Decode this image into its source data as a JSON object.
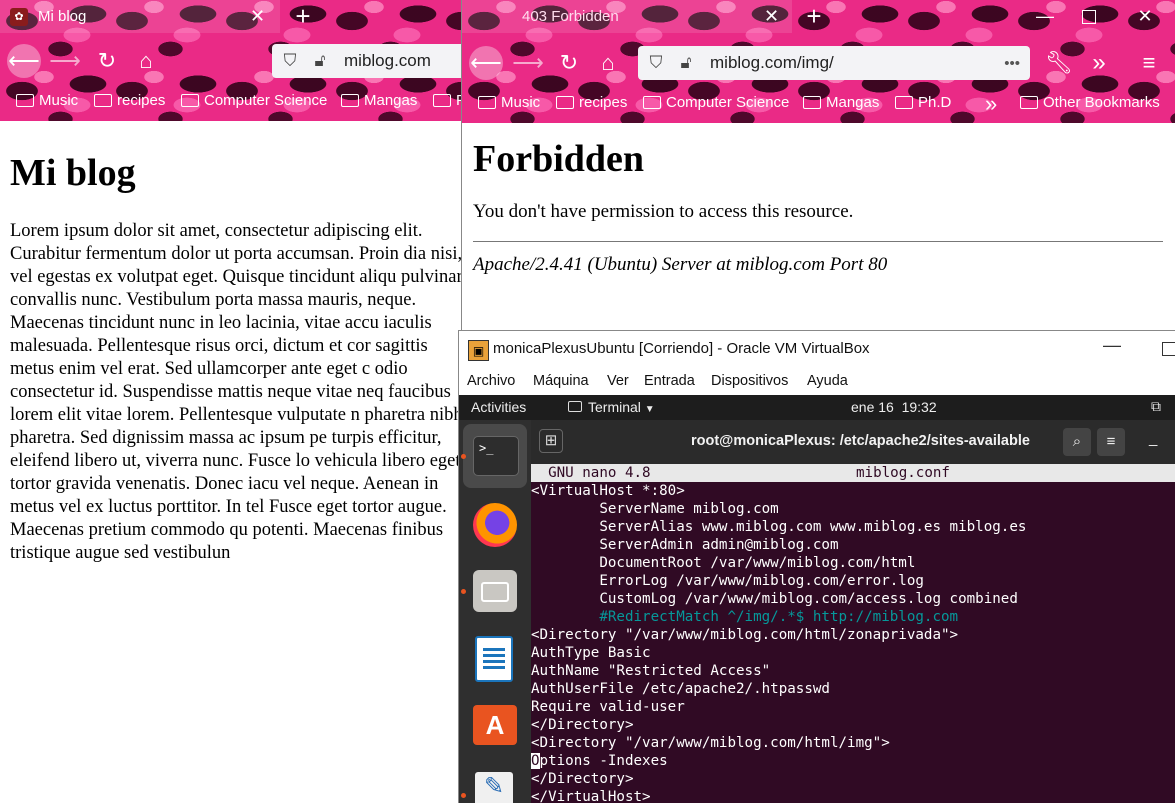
{
  "left_browser": {
    "tab_title": "Mi blog",
    "url": "miblog.com",
    "bookmarks": [
      "Music",
      "recipes",
      "Computer Science",
      "Mangas",
      "P"
    ],
    "page": {
      "heading": "Mi blog",
      "body": "Lorem ipsum dolor sit amet, consectetur adipiscing elit. Curabitur fermentum dolor ut porta accumsan. Proin dia nisi, vel egestas ex volutpat eget. Quisque tincidunt aliqu pulvinar convallis nunc. Vestibulum porta massa mauris, neque. Maecenas tincidunt nunc in leo lacinia, vitae accu iaculis malesuada. Pellentesque risus orci, dictum et cor sagittis metus enim vel erat. Sed ullamcorper ante eget c odio consectetur id. Suspendisse mattis neque vitae neq faucibus lorem elit vitae lorem. Pellentesque vulputate n pharetra nibh pharetra. Sed dignissim massa ac ipsum pe turpis efficitur, eleifend libero ut, viverra nunc. Fusce lo vehicula libero eget tortor gravida venenatis. Donec iacu vel neque. Aenean in metus vel ex luctus porttitor. In tel Fusce eget tortor augue. Maecenas pretium commodo qu potenti. Maecenas finibus tristique augue sed vestibulun"
    }
  },
  "right_browser": {
    "tab_title": "403 Forbidden",
    "url": "miblog.com/img/",
    "url_more": "•••",
    "overflow_label": "»",
    "bookmarks": [
      "Music",
      "recipes",
      "Computer Science",
      "Mangas",
      "Ph.D"
    ],
    "other_bookmarks": "Other Bookmarks",
    "page": {
      "heading": "Forbidden",
      "message": "You don't have permission to access this resource.",
      "server_signature": "Apache/2.4.41 (Ubuntu) Server at miblog.com Port 80"
    }
  },
  "virtualbox": {
    "title": "monicaPlexusUbuntu [Corriendo] - Oracle VM VirtualBox",
    "menu": [
      "Archivo",
      "Máquina",
      "Ver",
      "Entrada",
      "Dispositivos",
      "Ayuda"
    ]
  },
  "ubuntu": {
    "activities": "Activities",
    "app_menu": "Terminal",
    "clock": "ene 16  19:32",
    "terminal_title": "root@monicaPlexus: /etc/apache2/sites-available",
    "nano_version": "  GNU nano 4.8",
    "nano_file": "miblog.conf",
    "lines": [
      {
        "text": "<VirtualHost *:80>",
        "comment": false
      },
      {
        "text": "        ServerName miblog.com",
        "comment": false
      },
      {
        "text": "        ServerAlias www.miblog.com www.miblog.es miblog.es",
        "comment": false
      },
      {
        "text": "        ServerAdmin admin@miblog.com",
        "comment": false
      },
      {
        "text": "        DocumentRoot /var/www/miblog.com/html",
        "comment": false
      },
      {
        "text": "        ErrorLog /var/www/miblog.com/error.log",
        "comment": false
      },
      {
        "text": "        CustomLog /var/www/miblog.com/access.log combined",
        "comment": false
      },
      {
        "text": "        #RedirectMatch ^/img/.*$ http://miblog.com",
        "comment": true
      },
      {
        "text": "<Directory \"/var/www/miblog.com/html/zonaprivada\">",
        "comment": false
      },
      {
        "text": "AuthType Basic",
        "comment": false
      },
      {
        "text": "AuthName \"Restricted Access\"",
        "comment": false
      },
      {
        "text": "AuthUserFile /etc/apache2/.htpasswd",
        "comment": false
      },
      {
        "text": "Require valid-user",
        "comment": false
      },
      {
        "text": "</Directory>",
        "comment": false
      },
      {
        "text": "<Directory \"/var/www/miblog.com/html/img\">",
        "comment": false
      },
      {
        "text": "Options -Indexes",
        "comment": false,
        "cursor": true
      },
      {
        "text": "</Directory>",
        "comment": false
      },
      {
        "text": "</VirtualHost>",
        "comment": false
      }
    ]
  },
  "colors": {
    "browser_theme": "#ea2a86",
    "terminal_bg": "#300a24",
    "terminal_text": "#ffffff",
    "terminal_comment": "#06989a",
    "ubuntu_topbar": "#1d1d1d",
    "dock_bg": "#2f2f2f",
    "dock_active": "#e95420"
  },
  "icons": [
    "back-arrow-icon",
    "forward-arrow-icon",
    "reload-icon",
    "home-icon",
    "shield-icon",
    "insecure-lock-icon",
    "wrench-icon",
    "overflow-chevron-icon",
    "hamburger-menu-icon",
    "folder-icon",
    "terminal-icon",
    "firefox-icon",
    "files-icon",
    "writer-icon",
    "software-icon",
    "text-editor-icon",
    "search-icon",
    "network-icon"
  ]
}
